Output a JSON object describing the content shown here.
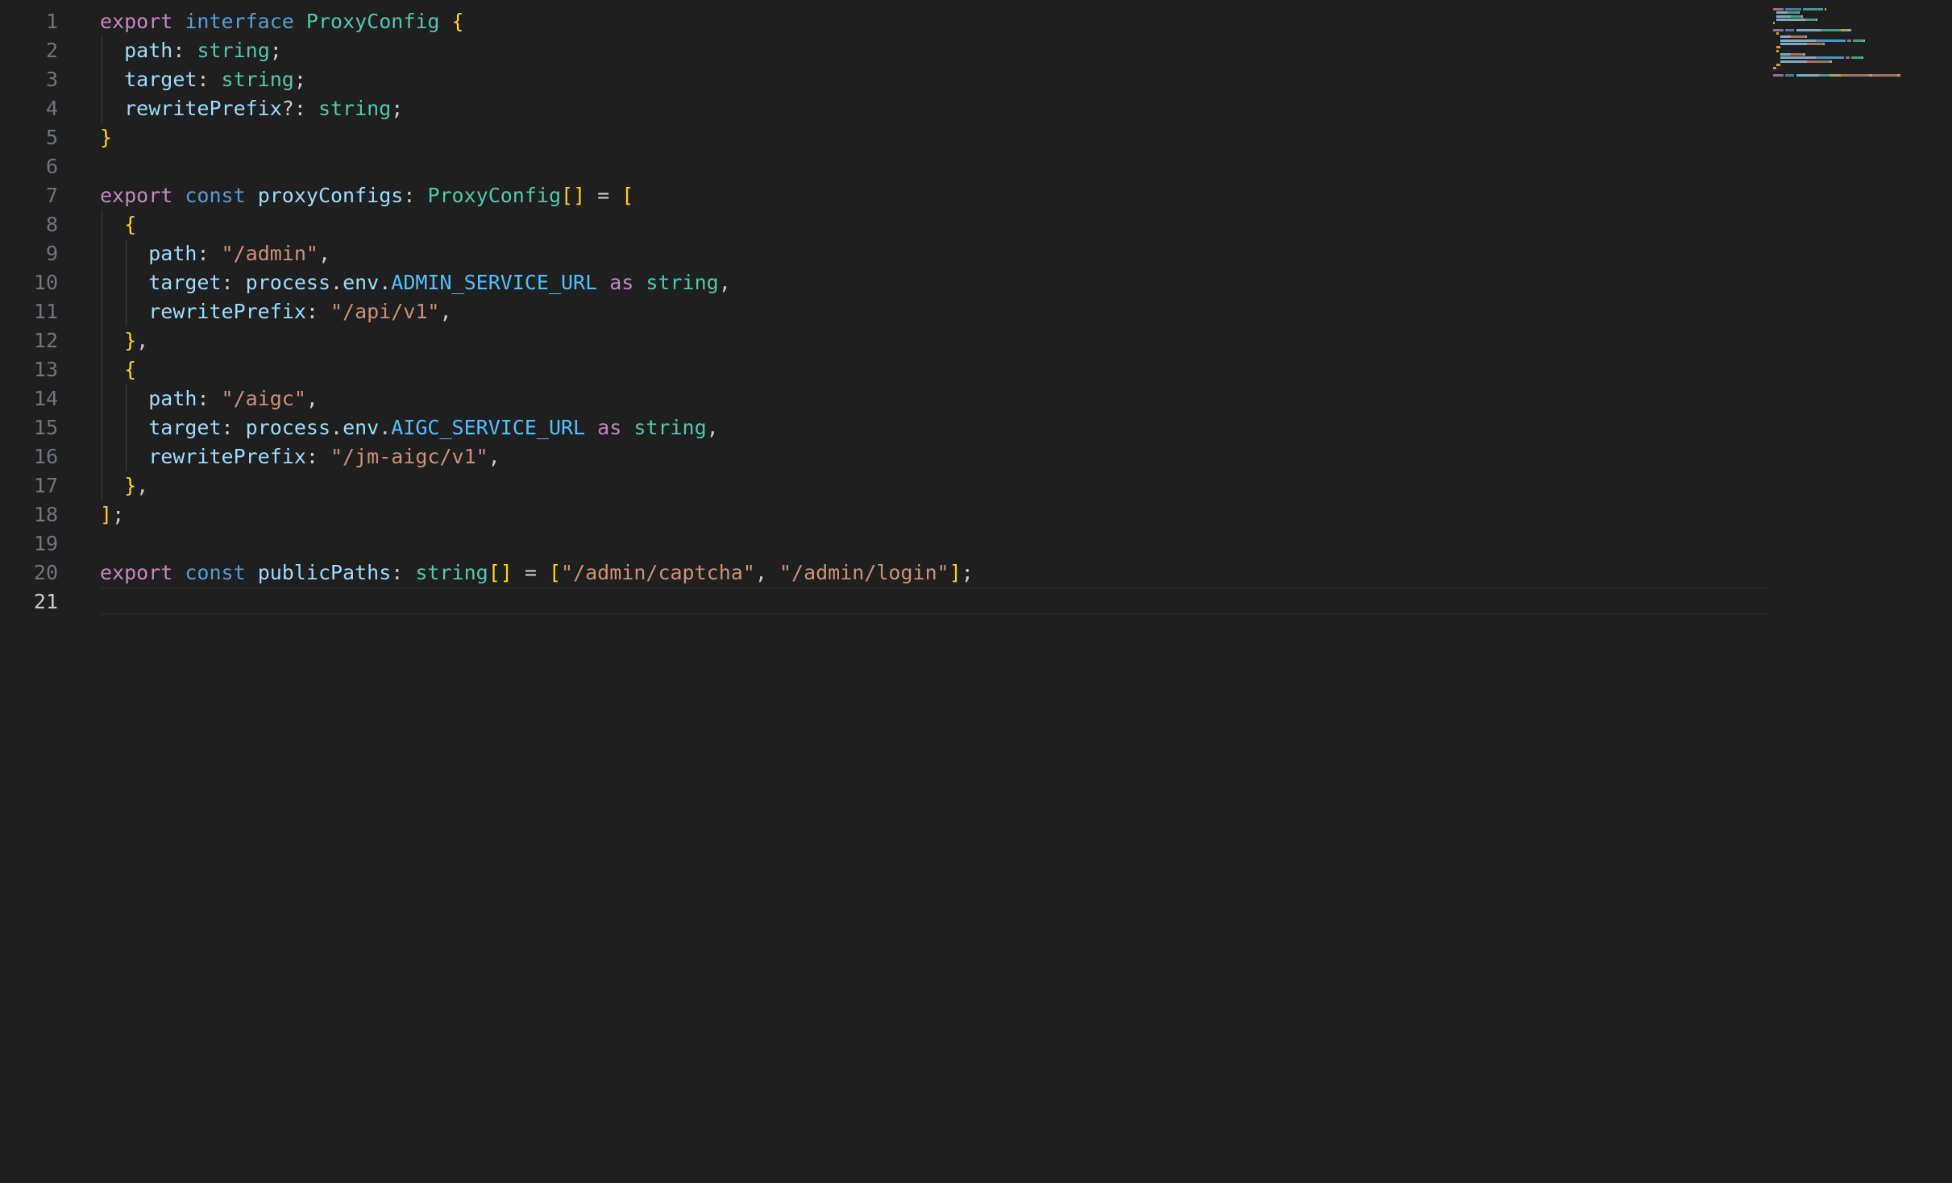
{
  "editor": {
    "active_line": 21,
    "colors": {
      "background": "#1f1f1f",
      "keyword": "#c586c0",
      "storage": "#569cd6",
      "type": "#4ec9b0",
      "variable": "#9cdcfe",
      "constant": "#4fc1ff",
      "string": "#ce9178",
      "bracket": "#ffd700",
      "plain": "#cccccc",
      "line_number": "#6e7681"
    },
    "lines": [
      {
        "number": "1",
        "tokens": [
          {
            "t": "export",
            "c": "kw"
          },
          {
            "t": " ",
            "c": "pl"
          },
          {
            "t": "interface",
            "c": "st"
          },
          {
            "t": " ",
            "c": "pl"
          },
          {
            "t": "ProxyConfig",
            "c": "ty"
          },
          {
            "t": " ",
            "c": "pl"
          },
          {
            "t": "{",
            "c": "b1"
          }
        ]
      },
      {
        "number": "2",
        "tokens": [
          {
            "t": "  ",
            "c": "pl"
          },
          {
            "t": "path",
            "c": "pr"
          },
          {
            "t": ": ",
            "c": "pl"
          },
          {
            "t": "string",
            "c": "ty"
          },
          {
            "t": ";",
            "c": "pl"
          }
        ]
      },
      {
        "number": "3",
        "tokens": [
          {
            "t": "  ",
            "c": "pl"
          },
          {
            "t": "target",
            "c": "pr"
          },
          {
            "t": ": ",
            "c": "pl"
          },
          {
            "t": "string",
            "c": "ty"
          },
          {
            "t": ";",
            "c": "pl"
          }
        ]
      },
      {
        "number": "4",
        "tokens": [
          {
            "t": "  ",
            "c": "pl"
          },
          {
            "t": "rewritePrefix",
            "c": "pr"
          },
          {
            "t": "?: ",
            "c": "pl"
          },
          {
            "t": "string",
            "c": "ty"
          },
          {
            "t": ";",
            "c": "pl"
          }
        ]
      },
      {
        "number": "5",
        "tokens": [
          {
            "t": "}",
            "c": "b1"
          }
        ]
      },
      {
        "number": "6",
        "tokens": []
      },
      {
        "number": "7",
        "tokens": [
          {
            "t": "export",
            "c": "kw"
          },
          {
            "t": " ",
            "c": "pl"
          },
          {
            "t": "const",
            "c": "st"
          },
          {
            "t": " ",
            "c": "pl"
          },
          {
            "t": "proxyConfigs",
            "c": "vr"
          },
          {
            "t": ": ",
            "c": "pl"
          },
          {
            "t": "ProxyConfig",
            "c": "ty"
          },
          {
            "t": "[]",
            "c": "b1"
          },
          {
            "t": " = ",
            "c": "pl"
          },
          {
            "t": "[",
            "c": "b1"
          }
        ]
      },
      {
        "number": "8",
        "tokens": [
          {
            "t": "  ",
            "c": "pl"
          },
          {
            "t": "{",
            "c": "b1"
          }
        ]
      },
      {
        "number": "9",
        "tokens": [
          {
            "t": "    ",
            "c": "pl"
          },
          {
            "t": "path",
            "c": "pr"
          },
          {
            "t": ": ",
            "c": "pl"
          },
          {
            "t": "\"/admin\"",
            "c": "sr"
          },
          {
            "t": ",",
            "c": "pl"
          }
        ]
      },
      {
        "number": "10",
        "tokens": [
          {
            "t": "    ",
            "c": "pl"
          },
          {
            "t": "target",
            "c": "pr"
          },
          {
            "t": ": ",
            "c": "pl"
          },
          {
            "t": "process",
            "c": "pr"
          },
          {
            "t": ".",
            "c": "pl"
          },
          {
            "t": "env",
            "c": "pr"
          },
          {
            "t": ".",
            "c": "pl"
          },
          {
            "t": "ADMIN_SERVICE_URL",
            "c": "cn"
          },
          {
            "t": " ",
            "c": "pl"
          },
          {
            "t": "as",
            "c": "kw"
          },
          {
            "t": " ",
            "c": "pl"
          },
          {
            "t": "string",
            "c": "ty"
          },
          {
            "t": ",",
            "c": "pl"
          }
        ]
      },
      {
        "number": "11",
        "tokens": [
          {
            "t": "    ",
            "c": "pl"
          },
          {
            "t": "rewritePrefix",
            "c": "pr"
          },
          {
            "t": ": ",
            "c": "pl"
          },
          {
            "t": "\"/api/v1\"",
            "c": "sr"
          },
          {
            "t": ",",
            "c": "pl"
          }
        ]
      },
      {
        "number": "12",
        "tokens": [
          {
            "t": "  ",
            "c": "pl"
          },
          {
            "t": "}",
            "c": "b1"
          },
          {
            "t": ",",
            "c": "pl"
          }
        ]
      },
      {
        "number": "13",
        "tokens": [
          {
            "t": "  ",
            "c": "pl"
          },
          {
            "t": "{",
            "c": "b1"
          }
        ]
      },
      {
        "number": "14",
        "tokens": [
          {
            "t": "    ",
            "c": "pl"
          },
          {
            "t": "path",
            "c": "pr"
          },
          {
            "t": ": ",
            "c": "pl"
          },
          {
            "t": "\"/aigc\"",
            "c": "sr"
          },
          {
            "t": ",",
            "c": "pl"
          }
        ]
      },
      {
        "number": "15",
        "tokens": [
          {
            "t": "    ",
            "c": "pl"
          },
          {
            "t": "target",
            "c": "pr"
          },
          {
            "t": ": ",
            "c": "pl"
          },
          {
            "t": "process",
            "c": "pr"
          },
          {
            "t": ".",
            "c": "pl"
          },
          {
            "t": "env",
            "c": "pr"
          },
          {
            "t": ".",
            "c": "pl"
          },
          {
            "t": "AIGC_SERVICE_URL",
            "c": "cn"
          },
          {
            "t": " ",
            "c": "pl"
          },
          {
            "t": "as",
            "c": "kw"
          },
          {
            "t": " ",
            "c": "pl"
          },
          {
            "t": "string",
            "c": "ty"
          },
          {
            "t": ",",
            "c": "pl"
          }
        ]
      },
      {
        "number": "16",
        "tokens": [
          {
            "t": "    ",
            "c": "pl"
          },
          {
            "t": "rewritePrefix",
            "c": "pr"
          },
          {
            "t": ": ",
            "c": "pl"
          },
          {
            "t": "\"/jm-aigc/v1\"",
            "c": "sr"
          },
          {
            "t": ",",
            "c": "pl"
          }
        ]
      },
      {
        "number": "17",
        "tokens": [
          {
            "t": "  ",
            "c": "pl"
          },
          {
            "t": "}",
            "c": "b1"
          },
          {
            "t": ",",
            "c": "pl"
          }
        ]
      },
      {
        "number": "18",
        "tokens": [
          {
            "t": "]",
            "c": "b1"
          },
          {
            "t": ";",
            "c": "pl"
          }
        ]
      },
      {
        "number": "19",
        "tokens": []
      },
      {
        "number": "20",
        "tokens": [
          {
            "t": "export",
            "c": "kw"
          },
          {
            "t": " ",
            "c": "pl"
          },
          {
            "t": "const",
            "c": "st"
          },
          {
            "t": " ",
            "c": "pl"
          },
          {
            "t": "publicPaths",
            "c": "vr"
          },
          {
            "t": ": ",
            "c": "pl"
          },
          {
            "t": "string",
            "c": "ty"
          },
          {
            "t": "[]",
            "c": "b1"
          },
          {
            "t": " = ",
            "c": "pl"
          },
          {
            "t": "[",
            "c": "b1"
          },
          {
            "t": "\"/admin/captcha\"",
            "c": "sr"
          },
          {
            "t": ", ",
            "c": "pl"
          },
          {
            "t": "\"/admin/login\"",
            "c": "sr"
          },
          {
            "t": "]",
            "c": "b1"
          },
          {
            "t": ";",
            "c": "pl"
          }
        ]
      },
      {
        "number": "21",
        "tokens": []
      }
    ]
  }
}
